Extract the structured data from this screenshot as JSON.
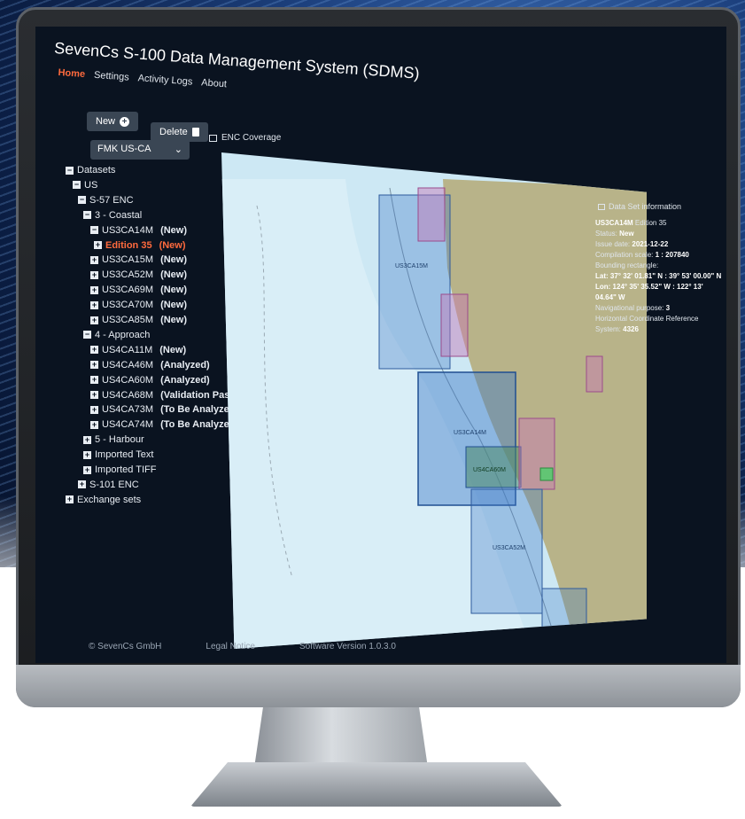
{
  "app": {
    "title": "SevenCs S-100 Data Management System (SDMS)",
    "menu": [
      "Home",
      "Settings",
      "Activity Logs",
      "About"
    ],
    "active_menu": "Home"
  },
  "toolbar": {
    "new_label": "New",
    "delete_label": "Delete",
    "selected_option": "FMK US-CA"
  },
  "tree": [
    {
      "label": "Datasets",
      "toggle": "−",
      "status": ""
    },
    {
      "label": "US",
      "toggle": "−",
      "status": ""
    },
    {
      "label": "S-57 ENC",
      "toggle": "−",
      "status": ""
    },
    {
      "label": "3 - Coastal",
      "toggle": "−",
      "status": ""
    },
    {
      "label": "US3CA14M",
      "toggle": "−",
      "status": "(New)"
    },
    {
      "label": "Edition 35",
      "toggle": "+",
      "status": "(New)",
      "highlight": true
    },
    {
      "label": "US3CA15M",
      "toggle": "+",
      "status": "(New)"
    },
    {
      "label": "US3CA52M",
      "toggle": "+",
      "status": "(New)"
    },
    {
      "label": "US3CA69M",
      "toggle": "+",
      "status": "(New)"
    },
    {
      "label": "US3CA70M",
      "toggle": "+",
      "status": "(New)"
    },
    {
      "label": "US3CA85M",
      "toggle": "+",
      "status": "(New)"
    },
    {
      "label": "4 - Approach",
      "toggle": "−",
      "status": ""
    },
    {
      "label": "US4CA11M",
      "toggle": "+",
      "status": "(New)"
    },
    {
      "label": "US4CA46M",
      "toggle": "+",
      "status": "(Analyzed)"
    },
    {
      "label": "US4CA60M",
      "toggle": "+",
      "status": "(Analyzed)"
    },
    {
      "label": "US4CA68M",
      "toggle": "+",
      "status": "(Validation Passed)"
    },
    {
      "label": "US4CA73M",
      "toggle": "+",
      "status": "(To Be Analyzed)"
    },
    {
      "label": "US4CA74M",
      "toggle": "+",
      "status": "(To Be Analyzed)"
    },
    {
      "label": "5 - Harbour",
      "toggle": "+",
      "status": ""
    },
    {
      "label": "Imported Text",
      "toggle": "+",
      "status": ""
    },
    {
      "label": "Imported TIFF",
      "toggle": "+",
      "status": ""
    },
    {
      "label": "S-101 ENC",
      "toggle": "+",
      "status": ""
    },
    {
      "label": "Exchange sets",
      "toggle": "+",
      "status": ""
    }
  ],
  "map": {
    "title": "ENC Coverage",
    "cell_labels": [
      "US3CA15M",
      "US3CA14M",
      "US4CA60M",
      "US3CA52M"
    ]
  },
  "info_panel": {
    "title": "Data Set information",
    "cell": "US3CA14M",
    "edition": "Edition 35",
    "status_label": "Status:",
    "status_value": "New",
    "issue_label": "Issue date:",
    "issue_value": "2021-12-22",
    "scale_label": "Compilation scale:",
    "scale_value": "1 : 207840",
    "bbox_label": "Bounding rectangle:",
    "lat_value": "Lat: 37° 32' 01.81\" N : 39° 53' 00.00\" N",
    "lon_value": "Lon: 124° 35' 35.52\" W : 122° 13' 04.64\" W",
    "purpose_label": "Navigational purpose:",
    "purpose_value": "3",
    "crs_label": "Horizontal Coordinate Reference System:",
    "crs_value": "4326"
  },
  "footer": {
    "copyright": "© SevenCs GmbH",
    "legal": "Legal Notice",
    "version": "Software Version 1.0.3.0"
  },
  "colors": {
    "accent": "#ff6a3d",
    "screen_bg": "#0a1320",
    "sea": "#cde8f4",
    "land": "#b8b389",
    "coverage_blue": "#3f79c7",
    "coverage_pink": "#c776b5"
  }
}
